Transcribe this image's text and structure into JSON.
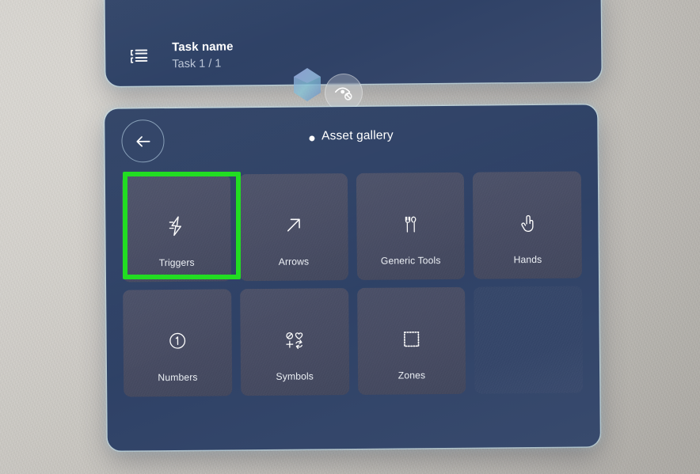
{
  "task_panel": {
    "icon": "task-list-icon",
    "title": "Task name",
    "progress": "Task 1 / 1"
  },
  "overlay": {
    "gem_icon": "gem-icon",
    "eye_badge_icon": "eye-off-icon"
  },
  "gallery": {
    "back_icon": "arrow-left-icon",
    "unsaved_indicator": "unsaved-dot",
    "title": "Asset gallery",
    "tiles": [
      {
        "icon": "lightning-bolt-icon",
        "label": "Triggers",
        "selected": true
      },
      {
        "icon": "arrow-up-right-icon",
        "label": "Arrows",
        "selected": false
      },
      {
        "icon": "tools-icon",
        "label": "Generic Tools",
        "selected": false
      },
      {
        "icon": "pointing-hand-icon",
        "label": "Hands",
        "selected": false
      },
      {
        "icon": "circled-one-icon",
        "label": "Numbers",
        "selected": false
      },
      {
        "icon": "symbols-grid-icon",
        "label": "Symbols",
        "selected": false
      },
      {
        "icon": "dashed-square-icon",
        "label": "Zones",
        "selected": false
      },
      {
        "icon": "",
        "label": "",
        "selected": false,
        "empty": true
      }
    ]
  },
  "colors": {
    "panel_blue": "#2e4266",
    "tile_grey": "#4b5068",
    "highlight_green": "#22dd22",
    "wall_beige": "#cfccc6",
    "panel_glow": "#c4e4f0"
  }
}
